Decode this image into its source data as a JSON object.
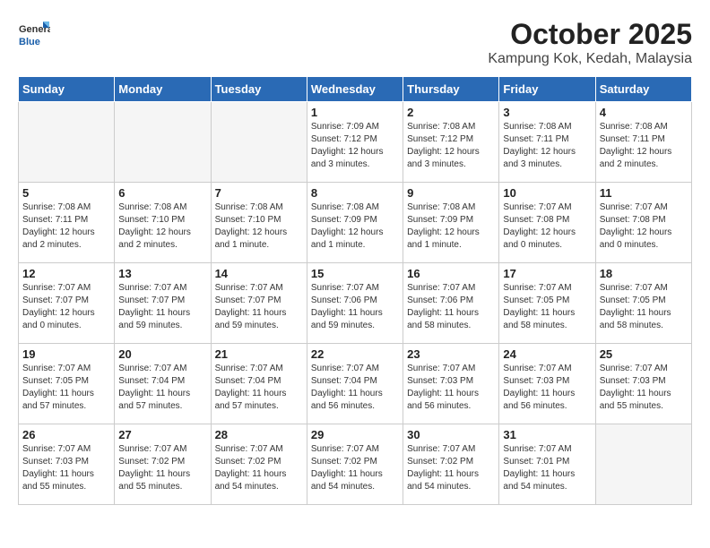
{
  "header": {
    "logo_general": "General",
    "logo_blue": "Blue",
    "month_title": "October 2025",
    "location": "Kampung Kok, Kedah, Malaysia"
  },
  "weekdays": [
    "Sunday",
    "Monday",
    "Tuesday",
    "Wednesday",
    "Thursday",
    "Friday",
    "Saturday"
  ],
  "weeks": [
    [
      {
        "day": "",
        "info": ""
      },
      {
        "day": "",
        "info": ""
      },
      {
        "day": "",
        "info": ""
      },
      {
        "day": "1",
        "info": "Sunrise: 7:09 AM\nSunset: 7:12 PM\nDaylight: 12 hours\nand 3 minutes."
      },
      {
        "day": "2",
        "info": "Sunrise: 7:08 AM\nSunset: 7:12 PM\nDaylight: 12 hours\nand 3 minutes."
      },
      {
        "day": "3",
        "info": "Sunrise: 7:08 AM\nSunset: 7:11 PM\nDaylight: 12 hours\nand 3 minutes."
      },
      {
        "day": "4",
        "info": "Sunrise: 7:08 AM\nSunset: 7:11 PM\nDaylight: 12 hours\nand 2 minutes."
      }
    ],
    [
      {
        "day": "5",
        "info": "Sunrise: 7:08 AM\nSunset: 7:11 PM\nDaylight: 12 hours\nand 2 minutes."
      },
      {
        "day": "6",
        "info": "Sunrise: 7:08 AM\nSunset: 7:10 PM\nDaylight: 12 hours\nand 2 minutes."
      },
      {
        "day": "7",
        "info": "Sunrise: 7:08 AM\nSunset: 7:10 PM\nDaylight: 12 hours\nand 1 minute."
      },
      {
        "day": "8",
        "info": "Sunrise: 7:08 AM\nSunset: 7:09 PM\nDaylight: 12 hours\nand 1 minute."
      },
      {
        "day": "9",
        "info": "Sunrise: 7:08 AM\nSunset: 7:09 PM\nDaylight: 12 hours\nand 1 minute."
      },
      {
        "day": "10",
        "info": "Sunrise: 7:07 AM\nSunset: 7:08 PM\nDaylight: 12 hours\nand 0 minutes."
      },
      {
        "day": "11",
        "info": "Sunrise: 7:07 AM\nSunset: 7:08 PM\nDaylight: 12 hours\nand 0 minutes."
      }
    ],
    [
      {
        "day": "12",
        "info": "Sunrise: 7:07 AM\nSunset: 7:07 PM\nDaylight: 12 hours\nand 0 minutes."
      },
      {
        "day": "13",
        "info": "Sunrise: 7:07 AM\nSunset: 7:07 PM\nDaylight: 11 hours\nand 59 minutes."
      },
      {
        "day": "14",
        "info": "Sunrise: 7:07 AM\nSunset: 7:07 PM\nDaylight: 11 hours\nand 59 minutes."
      },
      {
        "day": "15",
        "info": "Sunrise: 7:07 AM\nSunset: 7:06 PM\nDaylight: 11 hours\nand 59 minutes."
      },
      {
        "day": "16",
        "info": "Sunrise: 7:07 AM\nSunset: 7:06 PM\nDaylight: 11 hours\nand 58 minutes."
      },
      {
        "day": "17",
        "info": "Sunrise: 7:07 AM\nSunset: 7:05 PM\nDaylight: 11 hours\nand 58 minutes."
      },
      {
        "day": "18",
        "info": "Sunrise: 7:07 AM\nSunset: 7:05 PM\nDaylight: 11 hours\nand 58 minutes."
      }
    ],
    [
      {
        "day": "19",
        "info": "Sunrise: 7:07 AM\nSunset: 7:05 PM\nDaylight: 11 hours\nand 57 minutes."
      },
      {
        "day": "20",
        "info": "Sunrise: 7:07 AM\nSunset: 7:04 PM\nDaylight: 11 hours\nand 57 minutes."
      },
      {
        "day": "21",
        "info": "Sunrise: 7:07 AM\nSunset: 7:04 PM\nDaylight: 11 hours\nand 57 minutes."
      },
      {
        "day": "22",
        "info": "Sunrise: 7:07 AM\nSunset: 7:04 PM\nDaylight: 11 hours\nand 56 minutes."
      },
      {
        "day": "23",
        "info": "Sunrise: 7:07 AM\nSunset: 7:03 PM\nDaylight: 11 hours\nand 56 minutes."
      },
      {
        "day": "24",
        "info": "Sunrise: 7:07 AM\nSunset: 7:03 PM\nDaylight: 11 hours\nand 56 minutes."
      },
      {
        "day": "25",
        "info": "Sunrise: 7:07 AM\nSunset: 7:03 PM\nDaylight: 11 hours\nand 55 minutes."
      }
    ],
    [
      {
        "day": "26",
        "info": "Sunrise: 7:07 AM\nSunset: 7:03 PM\nDaylight: 11 hours\nand 55 minutes."
      },
      {
        "day": "27",
        "info": "Sunrise: 7:07 AM\nSunset: 7:02 PM\nDaylight: 11 hours\nand 55 minutes."
      },
      {
        "day": "28",
        "info": "Sunrise: 7:07 AM\nSunset: 7:02 PM\nDaylight: 11 hours\nand 54 minutes."
      },
      {
        "day": "29",
        "info": "Sunrise: 7:07 AM\nSunset: 7:02 PM\nDaylight: 11 hours\nand 54 minutes."
      },
      {
        "day": "30",
        "info": "Sunrise: 7:07 AM\nSunset: 7:02 PM\nDaylight: 11 hours\nand 54 minutes."
      },
      {
        "day": "31",
        "info": "Sunrise: 7:07 AM\nSunset: 7:01 PM\nDaylight: 11 hours\nand 54 minutes."
      },
      {
        "day": "",
        "info": ""
      }
    ]
  ]
}
